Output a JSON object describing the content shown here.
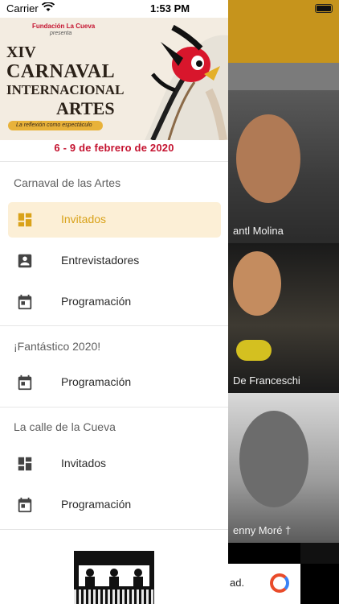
{
  "status_bar": {
    "carrier": "Carrier",
    "time": "1:53 PM",
    "wifi_icon": "wifi-icon",
    "battery_icon": "battery-icon"
  },
  "banner": {
    "foundation": "Fundación La Cueva",
    "presenta": "presenta",
    "edition": "XIV",
    "line1": "CARNAVAL",
    "line2": "INTERNACIONAL",
    "line3": "ARTES",
    "tagline": "La reflexión como espectáculo"
  },
  "dates": "6 - 9 de febrero de 2020",
  "sections": [
    {
      "title": "Carnaval de las Artes",
      "items": [
        {
          "label": "Invitados",
          "icon": "dashboard-icon",
          "active": true
        },
        {
          "label": "Entrevistadores",
          "icon": "account-box-icon",
          "active": false
        },
        {
          "label": "Programación",
          "icon": "calendar-icon",
          "active": false
        }
      ]
    },
    {
      "title": "¡Fantástico 2020!",
      "items": [
        {
          "label": "Programación",
          "icon": "calendar-icon",
          "active": false
        }
      ]
    },
    {
      "title": "La calle de la Cueva",
      "items": [
        {
          "label": "Invitados",
          "icon": "dashboard-icon",
          "active": false
        },
        {
          "label": "Programación",
          "icon": "calendar-icon",
          "active": false
        }
      ]
    }
  ],
  "background": {
    "cards": [
      {
        "caption": "antl Molina"
      },
      {
        "caption": "De Franceschi"
      },
      {
        "caption": "enny Moré †"
      }
    ],
    "ad_text": "ad."
  },
  "colors": {
    "accent": "#d9a21a",
    "active_bg": "#fcefd6",
    "date_red": "#c4122f",
    "header_gold": "#c6941c"
  }
}
